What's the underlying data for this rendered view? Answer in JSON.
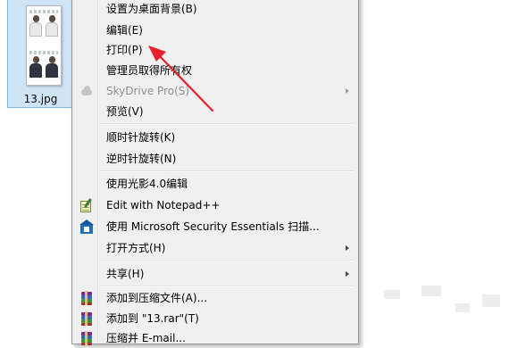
{
  "file": {
    "name": "13.jpg"
  },
  "menu": {
    "items": [
      {
        "label": "设置为桌面背景(B)"
      },
      {
        "label": "编辑(E)"
      },
      {
        "label": "打印(P)"
      },
      {
        "label": "管理员取得所有权"
      },
      {
        "label": "SkyDrive Pro(S)",
        "icon": "cloud-icon",
        "submenu": true,
        "disabled": true
      },
      {
        "label": "预览(V)"
      },
      {
        "label": "顺时针旋转(K)"
      },
      {
        "label": "逆时针旋转(N)"
      },
      {
        "label": "使用光影4.0编辑"
      },
      {
        "label": "Edit with Notepad++",
        "icon": "notepad-icon"
      },
      {
        "label": "使用 Microsoft Security Essentials 扫描...",
        "icon": "shield-icon"
      },
      {
        "label": "打开方式(H)",
        "submenu": true
      },
      {
        "label": "共享(H)",
        "submenu": true
      },
      {
        "label": "添加到压缩文件(A)...",
        "icon": "winrar-icon"
      },
      {
        "label": "添加到 \"13.rar\"(T)",
        "icon": "winrar-icon"
      },
      {
        "label": "压缩并 E-mail...",
        "icon": "winrar-icon"
      }
    ]
  },
  "annotation": {
    "color": "#e8202a",
    "points_to": "打印(P)"
  },
  "colors": {
    "menu_bg": "#f0f0f0",
    "selection_tile": "#cfe4f7",
    "accent_arrow": "#e8202a"
  }
}
